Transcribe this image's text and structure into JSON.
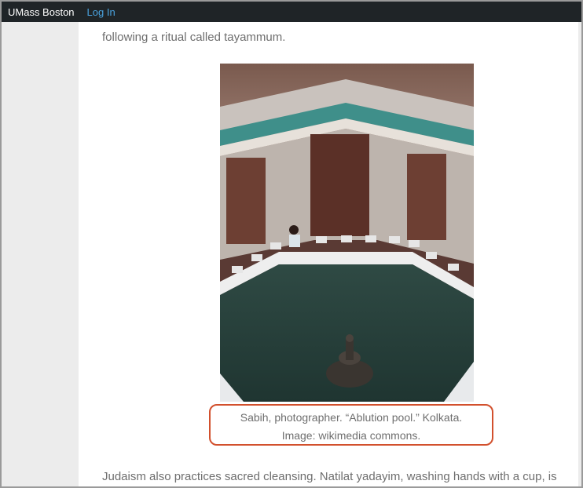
{
  "topbar": {
    "brand": "UMass Boston",
    "login_label": "Log In"
  },
  "article": {
    "paragraph_top": "following a ritual called tayammum.",
    "paragraph_bottom": "Judaism also practices sacred cleansing. Natilat yadayim, washing hands with a cup, is",
    "caption_line1": "Sabih, photographer. “Ablution pool.” Kolkata.",
    "caption_line2": "Image: wikimedia commons."
  },
  "colors": {
    "topbar_bg": "#1f2427",
    "link": "#4aa3df",
    "caption_border": "#d2502d",
    "body_text": "#6e6e6e"
  }
}
